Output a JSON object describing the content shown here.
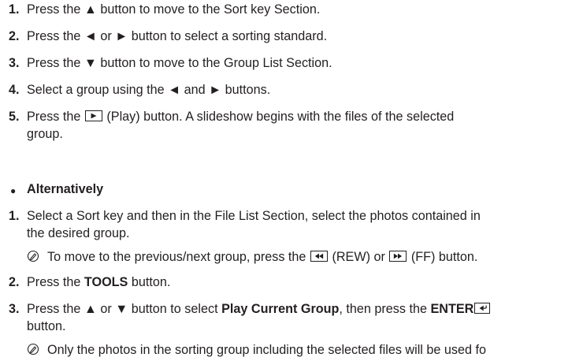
{
  "steps_a": [
    {
      "num": "1.",
      "pre": "Press the ▲ button to move to the Sort key Section."
    },
    {
      "num": "2.",
      "pre": "Press the ◄ or ► button to select a sorting standard."
    },
    {
      "num": "3.",
      "pre": "Press the ▼ button to move to the Group List Section."
    },
    {
      "num": "4.",
      "pre": "Select a group using the ◄ and ► buttons."
    },
    {
      "num": "5.",
      "pre": "Press the",
      "post": "(Play) button.  A slideshow begins with the files of the selected",
      "cont": "group."
    }
  ],
  "alt": {
    "bullet": "●",
    "heading": "Alternatively"
  },
  "steps_b": {
    "s1": {
      "num": "1.",
      "line1": "Select a Sort key and then in the File List Section, select the photos contained in",
      "line2": "the desired group."
    },
    "note1": {
      "pre": "To move to the previous/next group, press the",
      "mid": "(REW) or",
      "post": "(FF) button."
    },
    "s2": {
      "num": "2.",
      "pre": "Press the ",
      "bold": "TOOLS",
      "post": " button."
    },
    "s3": {
      "num": "3.",
      "pre": "Press the ▲ or ▼ button to select ",
      "bold1": "Play Current Group",
      "mid": ", then press the ",
      "bold2": "ENTER",
      "cont": "button."
    },
    "note2": {
      "text": "Only the photos in the sorting group including the selected files will be used fo"
    }
  },
  "icons": [
    "play-key-icon",
    "rewind-key-icon",
    "fast-forward-key-icon",
    "enter-key-icon",
    "note-icon"
  ]
}
